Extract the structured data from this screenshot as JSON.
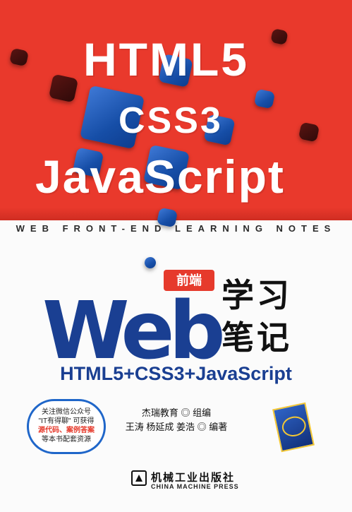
{
  "cover": {
    "titles": {
      "line1": "HTML5",
      "line2": "CSS3",
      "line3": "JavaScript"
    },
    "tagline": "WEB FRONT-END LEARNING NOTES",
    "qianduan": "前端",
    "web": "Web",
    "xuexi": "学习",
    "biji": "笔记",
    "subtitle": "HTML5+CSS3+JavaScript",
    "bubble": {
      "line1": "关注微信公众号",
      "line2": "\"IT有得聊\" 可获得",
      "line3": "源代码、案例答案",
      "line4": "等本书配套资源"
    },
    "editor": "杰瑞教育 ◎ 组编",
    "authors": "王涛  杨延成  姜浩 ◎ 编著",
    "publisher_cn": "机械工业出版社",
    "publisher_en": "CHINA MACHINE PRESS",
    "colors": {
      "red": "#e9392c",
      "blue": "#1a3f92",
      "accent": "#e63a2c"
    }
  }
}
